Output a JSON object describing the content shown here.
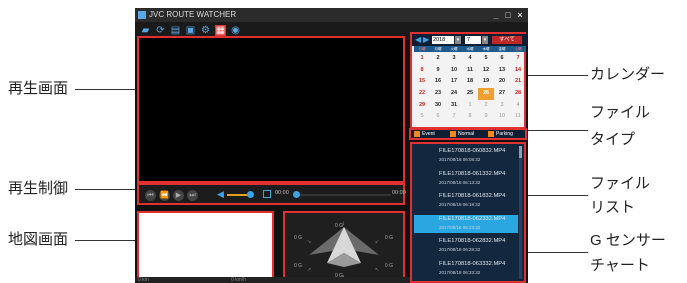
{
  "window": {
    "title": "JVC ROUTE WATCHER",
    "controls": [
      "_",
      "□",
      "×"
    ]
  },
  "toolbar": {
    "icons": [
      "folder-icon",
      "refresh-icon",
      "save-icon",
      "image-icon",
      "settings-icon",
      "map-icon",
      "location-icon"
    ]
  },
  "player": {
    "time_current": "00:00",
    "time_total": "00:00"
  },
  "calendar": {
    "year": "2018",
    "month": "7",
    "all_button": "すべて",
    "weekdays": [
      "日曜",
      "月曜",
      "火曜",
      "水曜",
      "木曜",
      "金曜",
      "土曜"
    ],
    "weeks": [
      [
        "1",
        "2",
        "3",
        "4",
        "5",
        "6",
        "7"
      ],
      [
        "8",
        "9",
        "10",
        "11",
        "12",
        "13",
        "14"
      ],
      [
        "15",
        "16",
        "17",
        "18",
        "19",
        "20",
        "21"
      ],
      [
        "22",
        "23",
        "24",
        "25",
        "26",
        "27",
        "28"
      ],
      [
        "29",
        "30",
        "31",
        "1",
        "2",
        "3",
        "4"
      ],
      [
        "5",
        "6",
        "7",
        "8",
        "9",
        "10",
        "11"
      ]
    ],
    "selected_day": "26"
  },
  "file_types": [
    "Event",
    "Normal",
    "Parking"
  ],
  "files": [
    {
      "name": "FILE170818-060832.MP4",
      "date": "2017/08/18   06:08:32",
      "selected": false
    },
    {
      "name": "FILE170818-061332.MP4",
      "date": "2017/08/18   06:13:32",
      "selected": false
    },
    {
      "name": "FILE170818-061832.MP4",
      "date": "2017/08/18   06:18:32",
      "selected": false
    },
    {
      "name": "FILE170818-062332.MP4",
      "date": "2017/08/18   06:23:32",
      "selected": true
    },
    {
      "name": "FILE170818-062832.MP4",
      "date": "2017/08/18   06:28:32",
      "selected": false
    },
    {
      "name": "FILE170818-063332.MP4",
      "date": "2017/08/18   06:33:32",
      "selected": false
    }
  ],
  "gsensor": {
    "labels": [
      "0 G",
      "0 G",
      "0 G",
      "0 G",
      "0 G",
      "0 G"
    ]
  },
  "status": {
    "left": "0 km",
    "right": "0 km/h"
  },
  "callouts": {
    "playback_screen": "再生画面",
    "playback_control": "再生制御",
    "map_screen": "地図画面",
    "calendar": "カレンダー",
    "file_type_1": "ファイル",
    "file_type_2": "タイプ",
    "file_list_1": "ファイル",
    "file_list_2": "リスト",
    "gsensor_1": "G センサー",
    "gsensor_2": "チャート"
  },
  "colors": {
    "highlight": "#e03030",
    "selected_file": "#2aa7e0",
    "selected_day": "#f0a030"
  }
}
